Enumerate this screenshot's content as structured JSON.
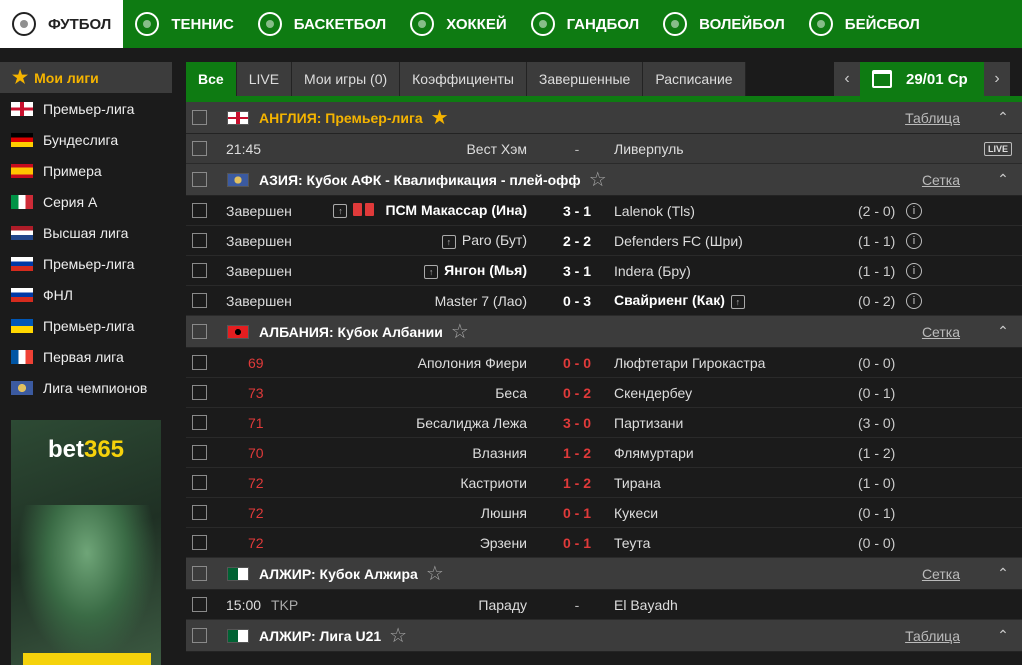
{
  "topnav": {
    "sports": [
      {
        "label": "ФУТБОЛ",
        "icon": "football-icon",
        "active": true
      },
      {
        "label": "ТЕННИС",
        "icon": "tennis-ball-icon"
      },
      {
        "label": "БАСКЕТБОЛ",
        "icon": "basketball-icon"
      },
      {
        "label": "ХОККЕЙ",
        "icon": "hockey-puck-icon"
      },
      {
        "label": "ГАНДБОЛ",
        "icon": "handball-icon"
      },
      {
        "label": "ВОЛЕЙБОЛ",
        "icon": "volleyball-icon"
      },
      {
        "label": "БЕЙСБОЛ",
        "icon": "baseball-icon"
      }
    ]
  },
  "sidebar": {
    "my_leagues": "Мои лиги",
    "leagues": [
      {
        "label": "Премьер-лига",
        "flag": "england"
      },
      {
        "label": "Бундеслига",
        "flag": "germany"
      },
      {
        "label": "Примера",
        "flag": "spain"
      },
      {
        "label": "Серия А",
        "flag": "italy"
      },
      {
        "label": "Высшая лига",
        "flag": "netherlands"
      },
      {
        "label": "Премьер-лига",
        "flag": "russia"
      },
      {
        "label": "ФНЛ",
        "flag": "russia"
      },
      {
        "label": "Премьер-лига",
        "flag": "ukraine"
      },
      {
        "label": "Первая лига",
        "flag": "france"
      },
      {
        "label": "Лига чемпионов",
        "flag": "world"
      }
    ],
    "banner": {
      "brand_a": "bet",
      "brand_b": "365"
    }
  },
  "tabs": [
    "Все",
    "LIVE",
    "Мои игры (0)",
    "Коэффициенты",
    "Завершенные",
    "Расписание"
  ],
  "date": {
    "label": "29/01 Ср",
    "prev": "‹",
    "next": "›"
  },
  "colors": {
    "accent_green": "#0e7b12",
    "live_red": "#e03a3a",
    "star": "#f5b400"
  },
  "sections": [
    {
      "flag": "england",
      "name": "АНГЛИЯ: Премьер-лига",
      "fav": true,
      "link": "Таблица",
      "matches": [
        {
          "time": "21:45",
          "home": "Вест Хэм",
          "score": "-",
          "away": "Ливерпуль",
          "live_badge": "LIVE",
          "highlight": true
        }
      ]
    },
    {
      "flag": "asia",
      "name": "АЗИЯ: Кубок АФК - Квалификация - плей-офф",
      "fav": false,
      "link": "Сетка",
      "matches": [
        {
          "time": "Завершен",
          "home": "ПСМ Макассар (Ина)",
          "home_bold": true,
          "home_tv": true,
          "red_cards": 2,
          "score": "3 - 1",
          "away": "Lalenok (Tls)",
          "ht": "(2 - 0)",
          "info": true
        },
        {
          "time": "Завершен",
          "home": "Paro (Бут)",
          "home_tv": true,
          "score": "2 - 2",
          "away": "Defenders FC (Шри)",
          "ht": "(1 - 1)",
          "info": true
        },
        {
          "time": "Завершен",
          "home": "Янгон (Мья)",
          "home_bold": true,
          "home_tv": true,
          "score": "3 - 1",
          "away": "Indera (Бру)",
          "ht": "(1 - 1)",
          "info": true
        },
        {
          "time": "Завершен",
          "home": "Master 7 (Лао)",
          "score": "0 - 3",
          "away": "Свайриенг (Как)",
          "away_bold": true,
          "away_tv": true,
          "ht": "(0 - 2)",
          "info": true
        }
      ]
    },
    {
      "flag": "albania",
      "name": "АЛБАНИЯ: Кубок Албании",
      "fav": false,
      "link": "Сетка",
      "matches": [
        {
          "time": "69",
          "live": true,
          "home": "Аполония Фиери",
          "score": "0 - 0",
          "away": "Люфтетари Гирокастра",
          "ht": "(0 - 0)"
        },
        {
          "time": "73",
          "live": true,
          "home": "Беса",
          "score": "0 - 2",
          "away": "Скендербеу",
          "ht": "(0 - 1)"
        },
        {
          "time": "71",
          "live": true,
          "home": "Бесалиджа Лежа",
          "score": "3 - 0",
          "away": "Партизани",
          "ht": "(3 - 0)"
        },
        {
          "time": "70",
          "live": true,
          "home": "Влазния",
          "score": "1 - 2",
          "away": "Флямуртари",
          "ht": "(1 - 2)"
        },
        {
          "time": "72",
          "live": true,
          "home": "Кастриоти",
          "score": "1 - 2",
          "away": "Тирана",
          "ht": "(1 - 0)"
        },
        {
          "time": "72",
          "live": true,
          "home": "Люшня",
          "score": "0 - 1",
          "away": "Кукеси",
          "ht": "(0 - 1)"
        },
        {
          "time": "72",
          "live": true,
          "home": "Эрзени",
          "score": "0 - 1",
          "away": "Теута",
          "ht": "(0 - 0)"
        }
      ]
    },
    {
      "flag": "algeria",
      "name": "АЛЖИР: Кубок Алжира",
      "fav": false,
      "link": "Сетка",
      "matches": [
        {
          "time": "15:00",
          "time_note": "TKP",
          "home": "Параду",
          "score": "-",
          "away": "El Bayadh"
        }
      ]
    },
    {
      "flag": "algeria",
      "name": "АЛЖИР: Лига U21",
      "fav": false,
      "link": "Таблица",
      "matches": []
    }
  ]
}
